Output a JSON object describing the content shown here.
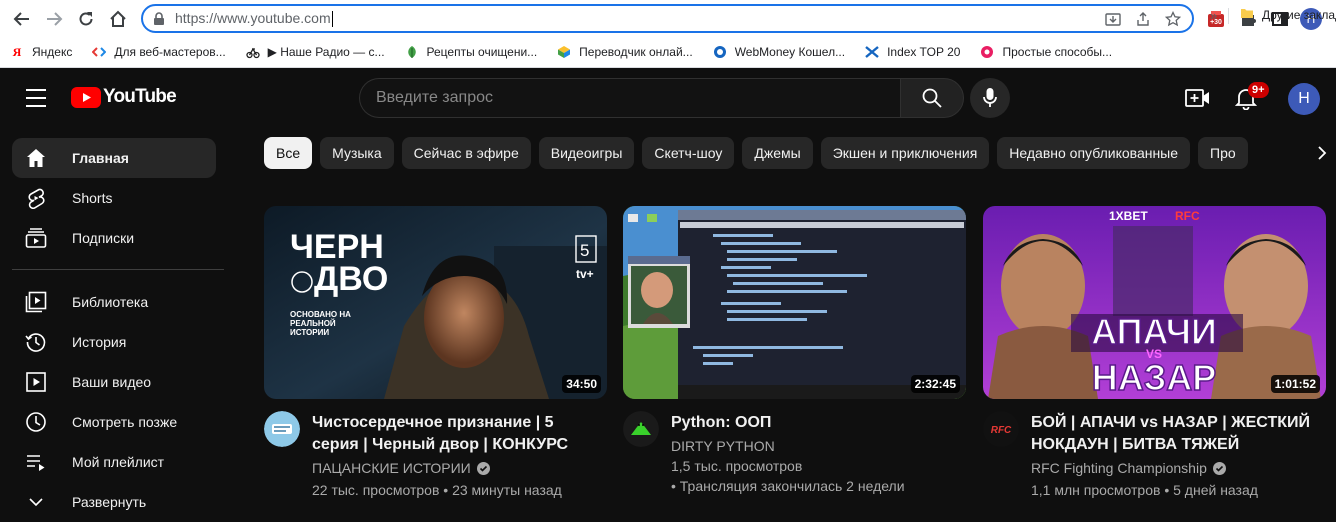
{
  "browser": {
    "url": "https://www.youtube.com",
    "ext_badge": "+30",
    "profile_initial": "Н",
    "bookmarks": [
      {
        "label": "Яндекс",
        "icon": "yandex-icon"
      },
      {
        "label": "Для веб-мастеров...",
        "icon": "code-icon"
      },
      {
        "label": "▶ Наше Радио — с...",
        "icon": "bike-icon"
      },
      {
        "label": "Рецепты очищени...",
        "icon": "leaf-icon"
      },
      {
        "label": "Переводчик онлай...",
        "icon": "translate-icon"
      },
      {
        "label": "WebMoney Кошел...",
        "icon": "webmoney-icon"
      },
      {
        "label": "Index TOP 20",
        "icon": "index-icon"
      },
      {
        "label": "Простые способы...",
        "icon": "flower-icon"
      }
    ],
    "more_bookmarks": "»",
    "other_bookmarks": "Другие закладки"
  },
  "youtube": {
    "logo_text": "YouTube",
    "search_placeholder": "Введите запрос",
    "notifications_badge": "9+",
    "avatar_initial": "Н",
    "sidebar": [
      {
        "label": "Главная",
        "icon": "home-icon",
        "active": true
      },
      {
        "label": "Shorts",
        "icon": "shorts-icon"
      },
      {
        "label": "Подписки",
        "icon": "subscriptions-icon"
      },
      {
        "label": "Библиотека",
        "icon": "library-icon"
      },
      {
        "label": "История",
        "icon": "history-icon"
      },
      {
        "label": "Ваши видео",
        "icon": "your-videos-icon"
      },
      {
        "label": "Смотреть позже",
        "icon": "watch-later-icon"
      },
      {
        "label": "Мой плейлист",
        "icon": "playlist-icon"
      },
      {
        "label": "Развернуть",
        "icon": "chevron-down-icon"
      }
    ],
    "chips": [
      "Все",
      "Музыка",
      "Сейчас в эфире",
      "Видеоигры",
      "Скетч-шоу",
      "Джемы",
      "Экшен и приключения",
      "Недавно опубликованные",
      "Про"
    ],
    "videos": [
      {
        "title": "Чистосердечное признание | 5 серия | Черный двор | КОНКУРС",
        "channel": "ПАЦАНСКИЕ ИСТОРИИ",
        "verified": true,
        "stats": "22 тыс. просмотров • 23 минуты назад",
        "duration": "34:50",
        "thumb_text": [
          "ЧЕРН",
          "ДВО",
          "ОСНОВАНО НА",
          "РЕАЛЬНОЙ",
          "ИСТОРИИ",
          "5",
          "tv+"
        ]
      },
      {
        "title": "Python: ООП",
        "channel": "DIRTY PYTHON",
        "verified": false,
        "stats_line1": "1,5 тыс. просмотров",
        "stats_line2": "• Трансляция закончилась 2 недели",
        "duration": "2:32:45"
      },
      {
        "title": "БОЙ | АПАЧИ vs НАЗАР | ЖЕСТКИЙ НОКДАУН | БИТВА ТЯЖЕЙ",
        "channel": "RFC Fighting Championship",
        "verified": true,
        "stats": "1,1 млн просмотров • 5 дней назад",
        "duration": "1:01:52",
        "thumb_text": [
          "АПАЧИ",
          "VS",
          "НАЗАР",
          "1XBET",
          "RFC"
        ]
      }
    ]
  },
  "colors": {
    "bg": "#0f0f0f",
    "chip_bg": "#272727",
    "accent_red": "#ff0000",
    "omnibox_border": "#1a73e8"
  }
}
